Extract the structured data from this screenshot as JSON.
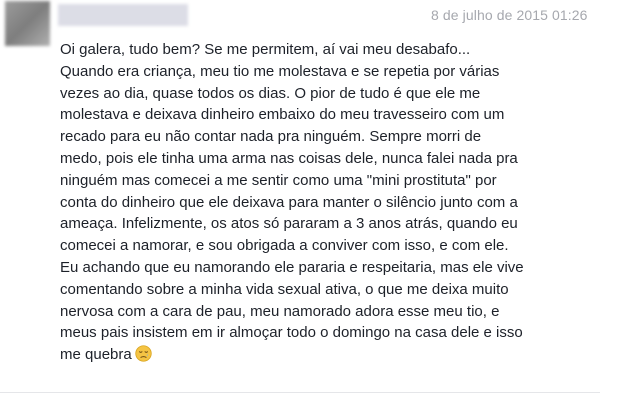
{
  "post": {
    "timestamp": "8 de julho de 2015 01:26",
    "lines": [
      "Oi galera, tudo bem? Se me permitem, aí vai meu desabafo...",
      "Quando era criança, meu tio me molestava e se repetia por várias",
      "vezes ao dia, quase todos os dias. O pior de tudo é que ele me",
      "molestava e deixava dinheiro embaixo do meu travesseiro com um",
      "recado para eu não contar nada pra ninguém. Sempre morri de",
      "medo, pois ele tinha uma arma nas coisas dele, nunca falei nada pra",
      "ninguém mas comecei a me sentir como uma \"mini prostituta\" por",
      "conta do dinheiro que ele deixava para manter o silêncio junto com a",
      "ameaça. Infelizmente, os atos só pararam a 3 anos atrás, quando eu",
      "comecei a namorar, e sou obrigada a conviver com isso, e com ele.",
      "Eu achando que eu namorando ele pararia e respeitaria, mas ele vive",
      "comentando sobre a minha vida sexual ativa, o que me deixa muito",
      "nervosa com a cara de pau, meu namorado adora esse meu tio, e",
      "meus pais insistem em ir almoçar todo o domingo na casa dele e isso",
      "me quebra"
    ],
    "emoji": "sad-face-emoji"
  },
  "colors": {
    "text": "#1d2129",
    "timestamp": "#a6a8ae",
    "emoji_face": "#f5c443"
  }
}
